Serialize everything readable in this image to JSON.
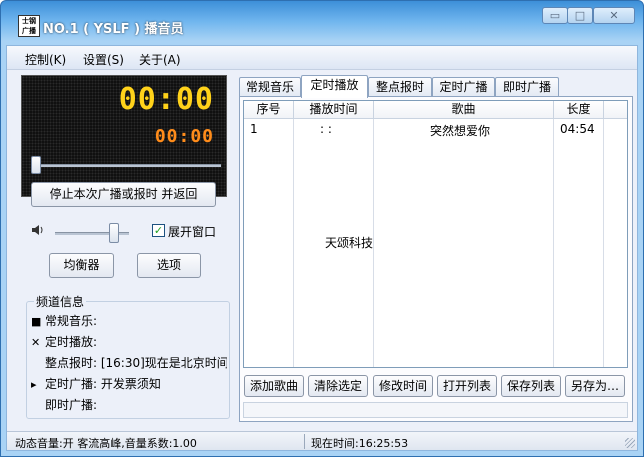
{
  "window": {
    "title": "NO.1 ( YSLF ) 播音员",
    "logo_text": "士 钢 广 播"
  },
  "menu": [
    {
      "label": "控制(K)"
    },
    {
      "label": "设置(S)"
    },
    {
      "label": "关于(A)"
    }
  ],
  "player": {
    "time_main": "00:00",
    "time_sub": "00:00",
    "progress_fraction": 0.0,
    "stop_button": "停止本次广播或报时 并返回",
    "volume_fraction": 0.85,
    "expand_window_label": "展开窗口",
    "expand_window_checked": true,
    "equalizer_button": "均衡器",
    "options_button": "选项"
  },
  "channel_info": {
    "title": "频道信息",
    "rows": [
      {
        "marker": "■",
        "text": "常规音乐:"
      },
      {
        "marker": "✕",
        "text": "定时播放:"
      },
      {
        "marker": "",
        "text": "整点报时: [16:30]现在是北京时间"
      },
      {
        "marker": "▸",
        "text": "定时广播: 开发票须知"
      },
      {
        "marker": "",
        "text": "即时广播:"
      }
    ]
  },
  "tabs": [
    {
      "label": "常规音乐",
      "active": false
    },
    {
      "label": "定时播放",
      "active": true
    },
    {
      "label": "整点报时",
      "active": false
    },
    {
      "label": "定时广播",
      "active": false
    },
    {
      "label": "即时广播",
      "active": false
    }
  ],
  "schedule_table": {
    "columns": [
      "序号",
      "播放时间",
      "歌曲",
      "长度"
    ],
    "rows": [
      {
        "index": "1",
        "time": ":   :",
        "song": "突然想爱你",
        "length": "04:54"
      }
    ],
    "watermark": "天颂科技"
  },
  "actions": [
    {
      "label": "添加歌曲"
    },
    {
      "label": "清除选定"
    },
    {
      "label": "修改时间"
    },
    {
      "label": "打开列表"
    },
    {
      "label": "保存列表"
    },
    {
      "label": "另存为…"
    }
  ],
  "status": {
    "left": "动态音量:开 客流高峰,音量系数:1.00",
    "right": "现在时间:16:25:53"
  },
  "colors": {
    "titlebar": "#3d8fd8",
    "led_main": "#ffd21a",
    "led_sub": "#ff8c1a"
  }
}
